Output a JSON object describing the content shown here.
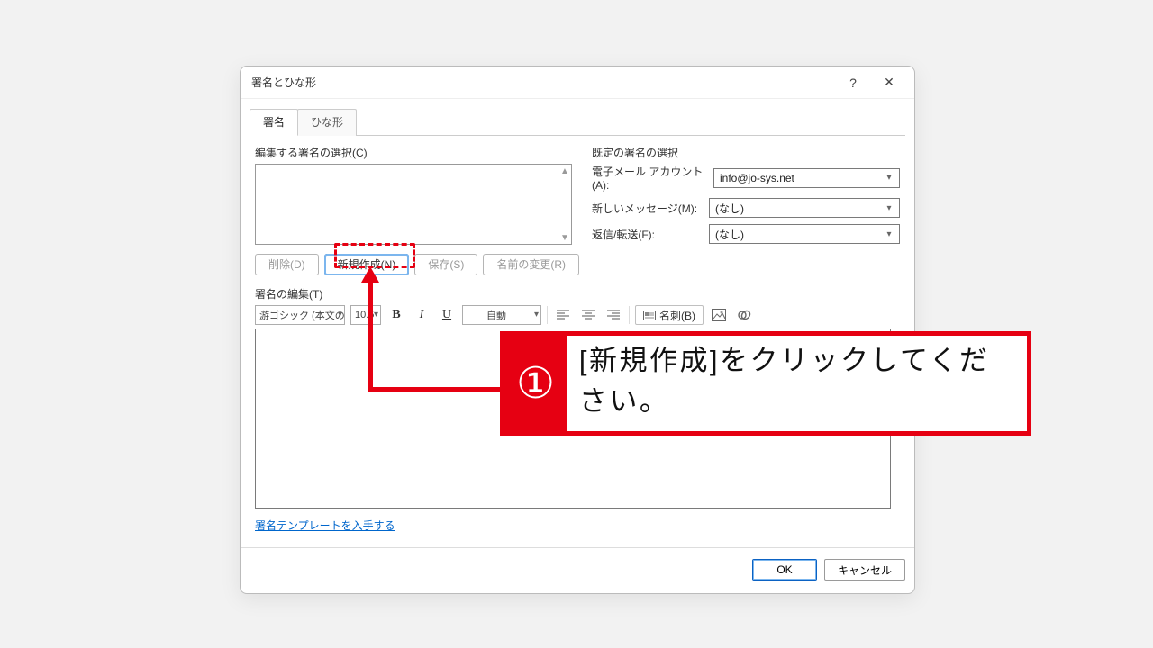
{
  "dialog": {
    "title": "署名とひな形",
    "help_label": "?",
    "close_label": "✕"
  },
  "tabs": {
    "signature": "署名",
    "stationery": "ひな形"
  },
  "left": {
    "select_label": "編集する署名の選択(C)",
    "scroll_up": "▲",
    "scroll_down": "▼"
  },
  "buttons": {
    "delete": "削除(D)",
    "new": "新規作成(N)",
    "save": "保存(S)",
    "rename": "名前の変更(R)"
  },
  "defaults": {
    "title": "既定の署名の選択",
    "account_label": "電子メール アカウント(A):",
    "account_value": "info@jo-sys.net",
    "newmsg_label": "新しいメッセージ(M):",
    "newmsg_value": "(なし)",
    "reply_label": "返信/転送(F):",
    "reply_value": "(なし)"
  },
  "editor": {
    "label": "署名の編集(T)",
    "font": "游ゴシック (本文のフォント)",
    "size": "10.5",
    "color": "自動",
    "business_card": "名刺(B)"
  },
  "link": "署名テンプレートを入手する",
  "footer": {
    "ok": "OK",
    "cancel": "キャンセル"
  },
  "instruction": {
    "badge": "①",
    "text": "[新規作成]をクリックしてください。"
  }
}
